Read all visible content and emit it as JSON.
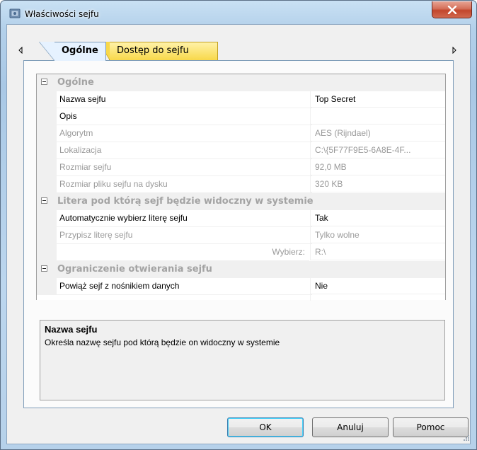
{
  "window": {
    "title": "Właściwości sejfu"
  },
  "tabs": [
    {
      "label": "Ogólne",
      "active": true
    },
    {
      "label": "Dostęp do sejfu",
      "active": false
    }
  ],
  "property_grid": {
    "categories": [
      {
        "label": "Ogólne"
      },
      {
        "label": "Litera pod którą sejf będzie widoczny w systemie"
      },
      {
        "label": "Ograniczenie otwierania sejfu"
      }
    ],
    "rows": {
      "name": {
        "label": "Nazwa sejfu",
        "value": "Top Secret"
      },
      "description": {
        "label": "Opis",
        "value": ""
      },
      "algorithm": {
        "label": "Algorytm",
        "value": "AES (Rijndael)"
      },
      "location": {
        "label": "Lokalizacja",
        "value": "C:\\{5F77F9E5-6A8E-4F..."
      },
      "size": {
        "label": "Rozmiar sejfu",
        "value": "92,0 MB"
      },
      "file_size": {
        "label": "Rozmiar pliku sejfu na dysku",
        "value": "320 KB"
      },
      "auto_letter": {
        "label": "Automatycznie wybierz literę sejfu",
        "value": "Tak"
      },
      "assign_letter": {
        "label": "Przypisz literę sejfu",
        "value": "Tylko wolne"
      },
      "choose": {
        "label": "Wybierz:",
        "value": "R:\\"
      },
      "bind_media": {
        "label": "Powiąż sejf z nośnikiem danych",
        "value": "Nie"
      }
    }
  },
  "description_panel": {
    "title": "Nazwa sejfu",
    "text": "Określa nazwę sejfu pod którą będzie on widoczny w systemie"
  },
  "buttons": {
    "ok": "OK",
    "cancel": "Anuluj",
    "help": "Pomoc"
  },
  "colors": {
    "active_tab": "#e6f2ff",
    "inactive_tab": "#f8d84a",
    "close_button": "#c2462c",
    "category_text": "#a3a3a3"
  }
}
